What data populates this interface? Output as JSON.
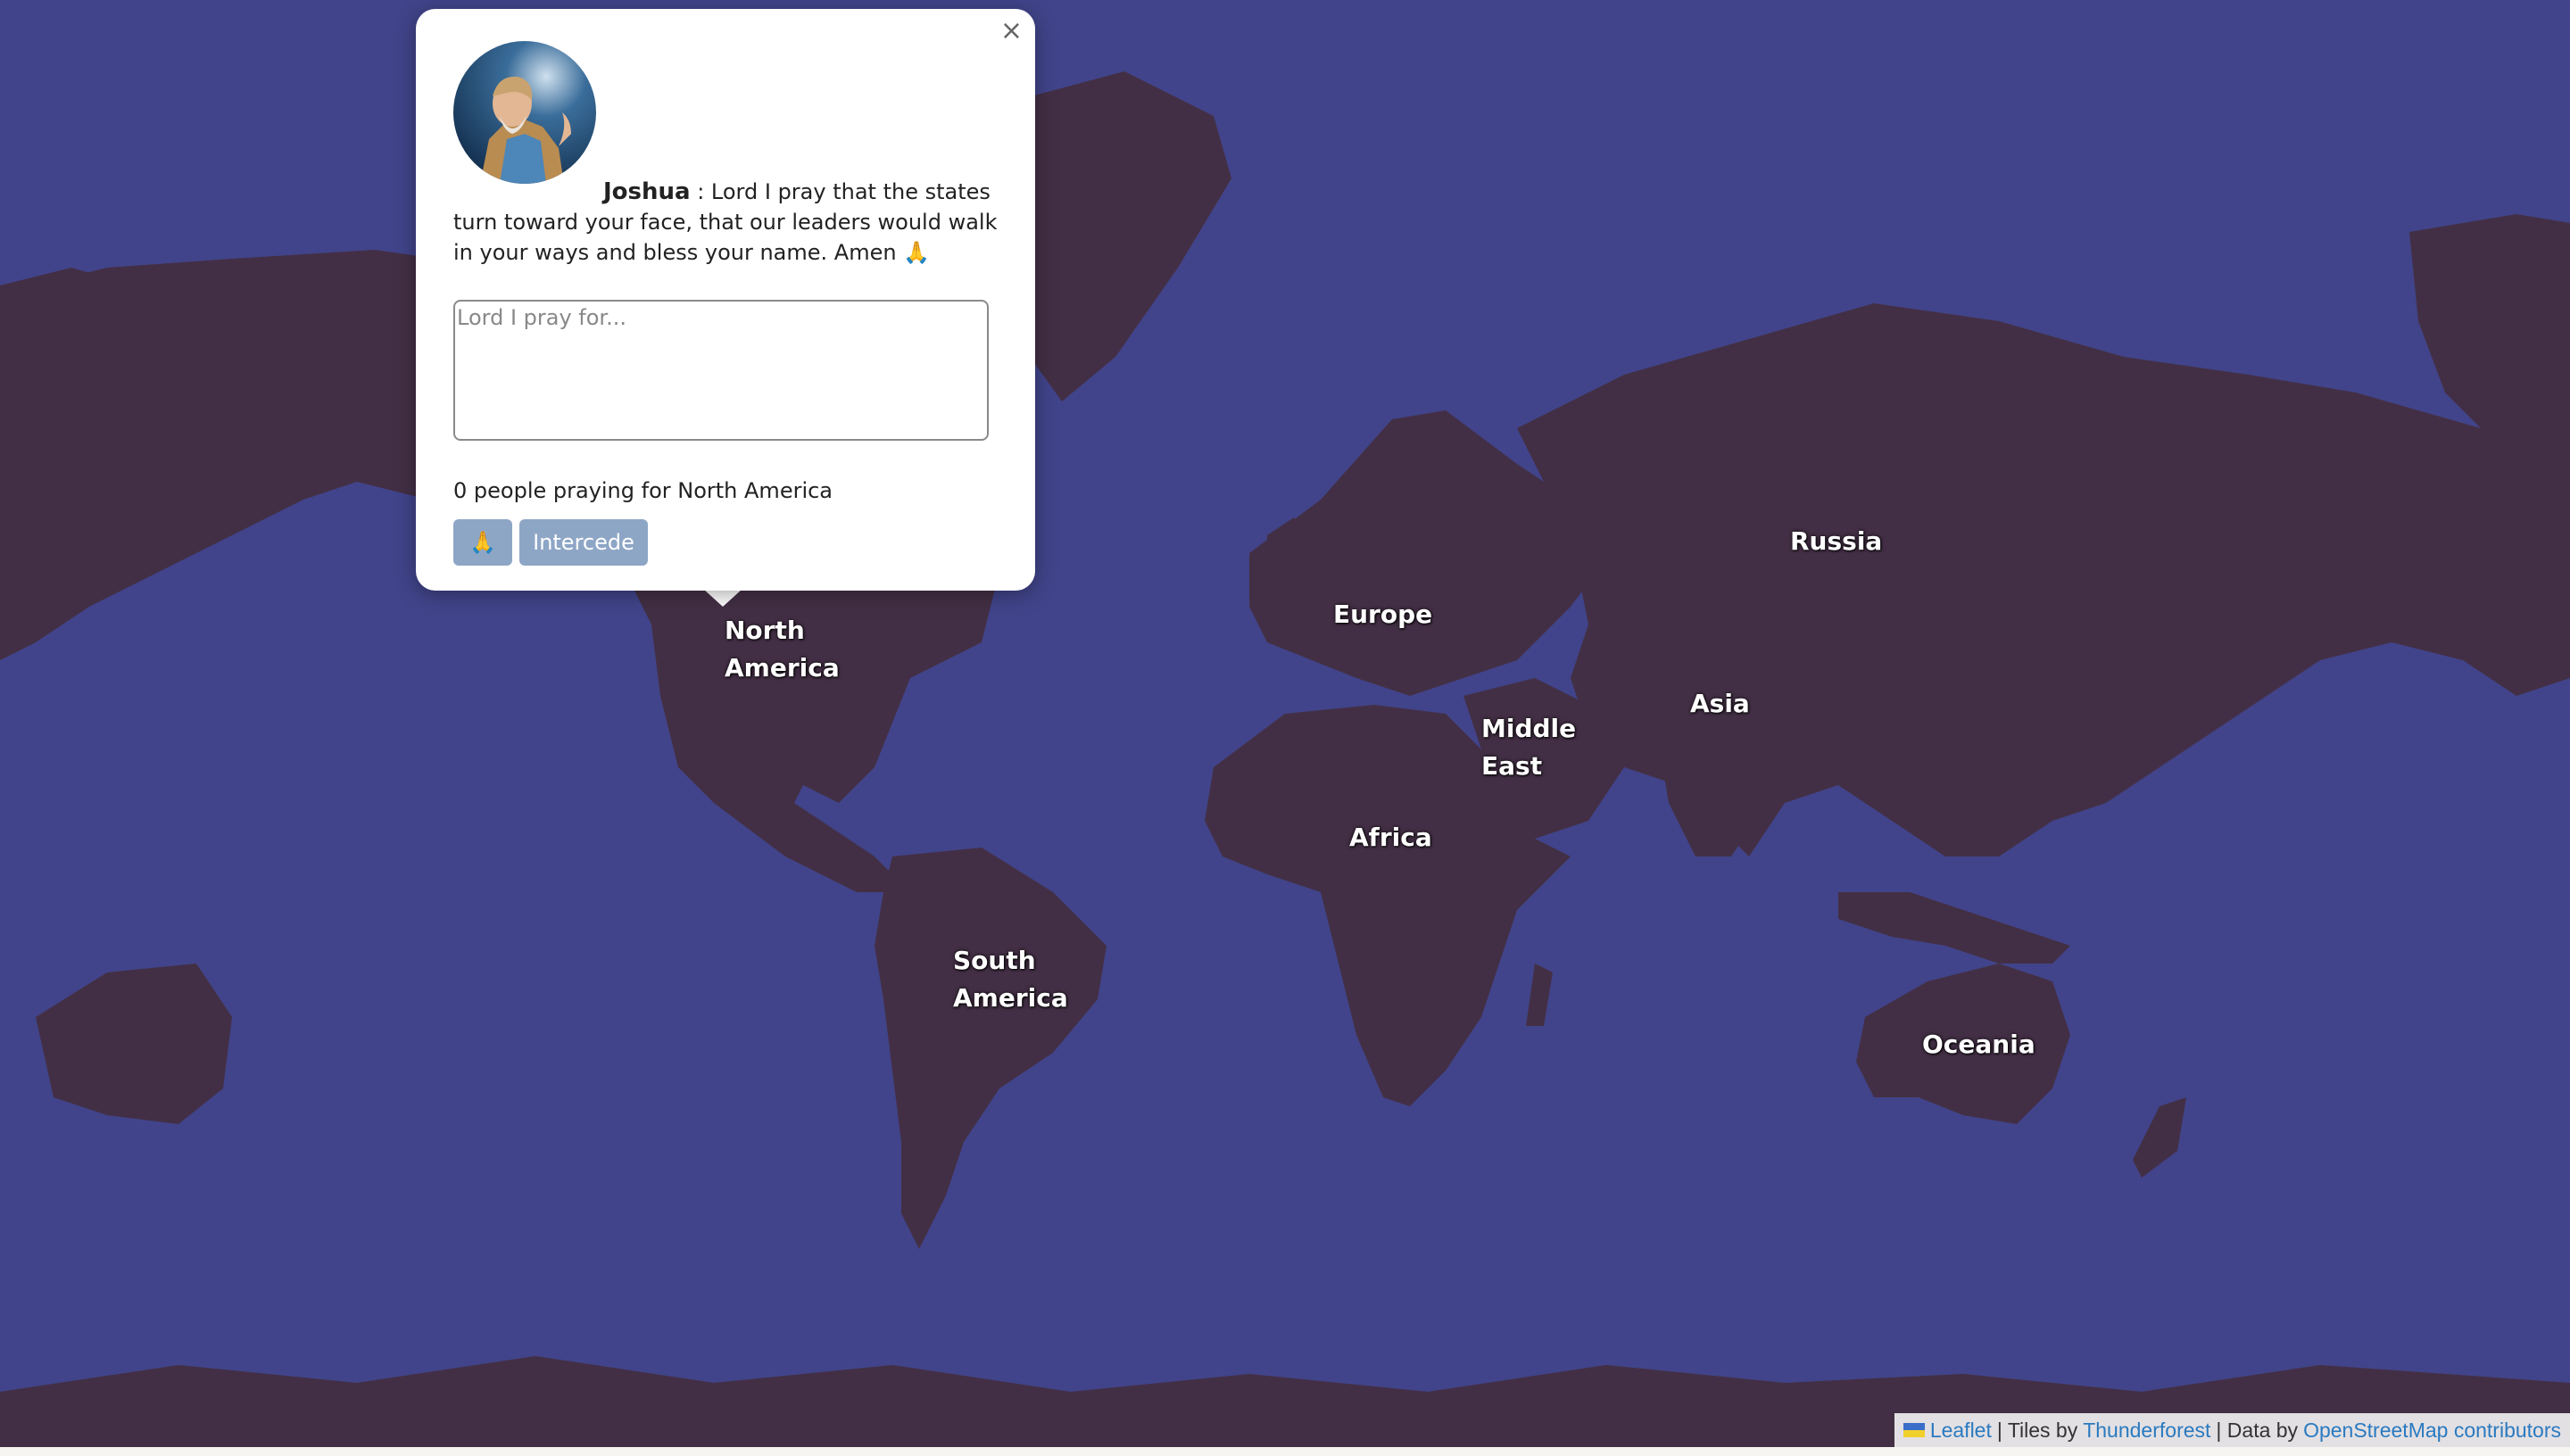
{
  "map": {
    "ocean_color": "#41448a",
    "land_color": "#432f45",
    "regions": [
      {
        "id": "north-america",
        "label": "North\nAmerica"
      },
      {
        "id": "south-america",
        "label": "South\nAmerica"
      },
      {
        "id": "europe",
        "label": "Europe"
      },
      {
        "id": "russia",
        "label": "Russia"
      },
      {
        "id": "asia",
        "label": "Asia"
      },
      {
        "id": "middle-east",
        "label": "Middle\nEast"
      },
      {
        "id": "africa",
        "label": "Africa"
      },
      {
        "id": "oceania",
        "label": "Oceania"
      }
    ]
  },
  "popup": {
    "close_glyph": "×",
    "author": "Joshua",
    "separator": " : ",
    "prayer": "Lord I pray that the states turn toward your face, that our leaders would walk in your ways and bless your name. Amen 🙏",
    "input_placeholder": "Lord I pray for...",
    "count_text": "0 people praying for North America",
    "pray_button": "🙏",
    "intercede_button": "Intercede",
    "button_color": "#8ea6c6"
  },
  "attribution": {
    "leaflet": "Leaflet",
    "tiles_prefix": "| Tiles by",
    "tiles_link": "Thunderforest",
    "data_prefix": "| Data by",
    "data_link": "OpenStreetMap contributors",
    "link_color": "#2a7ac0"
  }
}
